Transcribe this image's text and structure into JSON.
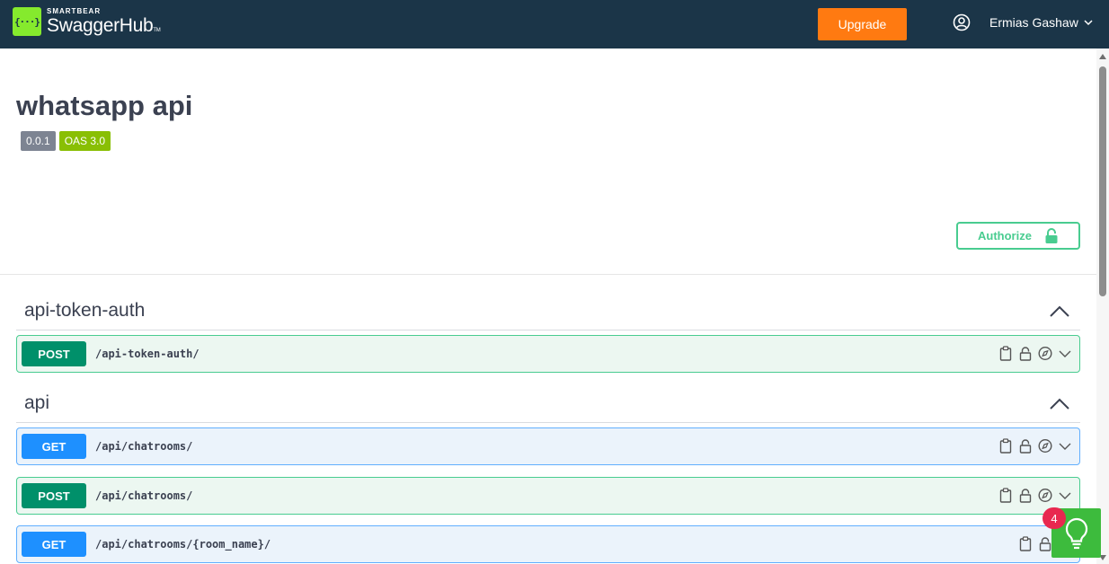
{
  "header": {
    "brand_small": "SMARTBEAR",
    "brand_name": "SwaggerHub",
    "brand_tm": "TM",
    "logo_glyph": "{···}",
    "upgrade_label": "Upgrade",
    "user_name": "Ermias Gashaw",
    "colors": {
      "background": "#1b3548",
      "upgrade": "#ff7a11",
      "logo": "#85ea2d"
    }
  },
  "info": {
    "title": "whatsapp api",
    "version_badge": "0.0.1",
    "oas_badge": "OAS 3.0",
    "authorize_label": "Authorize"
  },
  "tags": [
    {
      "name": "api-token-auth",
      "operations": [
        {
          "method": "POST",
          "path": "/api-token-auth/"
        }
      ]
    },
    {
      "name": "api",
      "operations": [
        {
          "method": "GET",
          "path": "/api/chatrooms/"
        },
        {
          "method": "POST",
          "path": "/api/chatrooms/"
        },
        {
          "method": "GET",
          "path": "/api/chatrooms/{room_name}/"
        }
      ]
    }
  ],
  "operation_icons": [
    "clipboard-icon",
    "lock-icon",
    "compass-icon",
    "chevron-down-icon"
  ],
  "help_widget": {
    "notification_count": "4",
    "icon": "lightbulb-icon"
  },
  "colors": {
    "post_method": "#00906a",
    "get_method": "#1e90ff",
    "post_row_bg": "#ecf7f1",
    "get_row_bg": "#ebf3fb",
    "authorize": "#49cc90",
    "oas_badge": "#89bf04"
  }
}
